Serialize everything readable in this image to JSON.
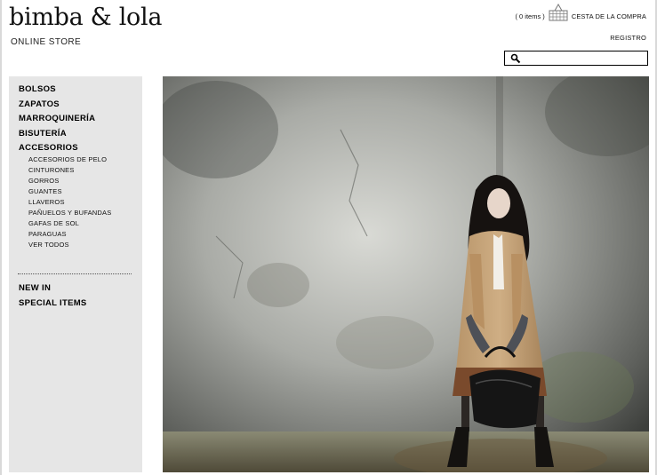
{
  "brand": {
    "name": "bimba & lola",
    "subtitle": "ONLINE STORE"
  },
  "header": {
    "cart_count": "( 0 items )",
    "cart_label": "CESTA DE LA COMPRA",
    "register_label": "REGISTRO",
    "search": {
      "placeholder": "",
      "value": ""
    }
  },
  "nav": {
    "main": [
      "BOLSOS",
      "ZAPATOS",
      "MARROQUINERÍA",
      "BISUTERÍA",
      "ACCESORIOS"
    ],
    "sub": [
      "ACCESORIOS DE PELO",
      "CINTURONES",
      "GORROS",
      "GUANTES",
      "LLAVEROS",
      "PAÑUELOS Y BUFANDAS",
      "GAFAS DE SOL",
      "PARAGUAS",
      "VER TODOS"
    ],
    "extra": [
      "NEW IN",
      "SPECIAL ITEMS"
    ]
  },
  "icons": {
    "cart": "shopping-basket-icon",
    "search": "magnifier-icon"
  },
  "colors": {
    "sidebar_bg": "#e6e6e6",
    "text": "#000000"
  }
}
